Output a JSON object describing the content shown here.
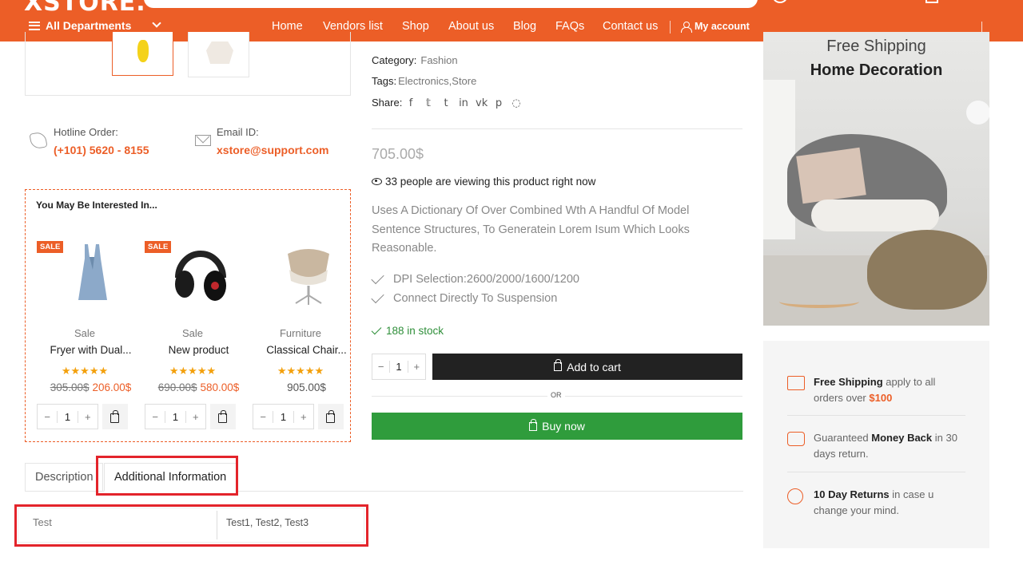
{
  "header": {
    "logo": "XSTORE.",
    "departments_label": "All Departments",
    "nav": [
      "Home",
      "Vendors list",
      "Shop",
      "About us",
      "Blog",
      "FAQs",
      "Contact us"
    ],
    "account_label": "My account"
  },
  "contact": {
    "hotline_label": "Hotline Order:",
    "hotline_value": "(+101) 5620 - 8155",
    "email_label": "Email ID:",
    "email_value": "xstore@support.com"
  },
  "interested": {
    "title": "You May Be Interested In...",
    "products": [
      {
        "badge": "SALE",
        "category": "Sale",
        "name": "Fryer with Dual...",
        "stars": "★★★★★",
        "old_price": "305.00$",
        "new_price": "206.00$",
        "qty": "1",
        "image": "dress-image"
      },
      {
        "badge": "SALE",
        "category": "Sale",
        "name": "New product",
        "stars": "★★★★★",
        "old_price": "690.00$",
        "new_price": "580.00$",
        "qty": "1",
        "image": "headphones-image"
      },
      {
        "badge": "",
        "category": "Furniture",
        "name": "Classical Chair...",
        "stars": "★★★★★",
        "old_price": "",
        "new_price": "905.00$",
        "qty": "1",
        "image": "chair-image"
      }
    ]
  },
  "tabs": {
    "description": "Description",
    "additional": "Additional Information"
  },
  "info_table": {
    "key": "Test",
    "value": "Test1, Test2, Test3"
  },
  "product": {
    "category_label": "Category:",
    "category_value": "Fashion",
    "tags_label": "Tags:",
    "tags_value": "Electronics,Store",
    "share_label": "Share:",
    "share_icons": [
      "facebook-icon",
      "twitter-icon",
      "tumblr-icon",
      "linkedin-icon",
      "vk-icon",
      "pinterest-icon",
      "whatsapp-icon"
    ],
    "price": "705.00$",
    "viewing": "33 people are viewing this product right now",
    "description": "Uses A Dictionary Of Over Combined Wth A Handful Of Model Sentence Structures, To Generatein Lorem Isum Which Looks Reasonable.",
    "features": [
      "DPI Selection:2600/2000/1600/1200",
      "Connect Directly To Suspension"
    ],
    "stock": "188 in stock",
    "qty": "1",
    "minus": "−",
    "plus": "+",
    "add_to_cart": "Add to cart",
    "or": "OR",
    "buy_now": "Buy now"
  },
  "banner": {
    "subtitle": "Free Shipping",
    "title": "Home Decoration"
  },
  "perks": {
    "shipping_bold": "Free Shipping",
    "shipping_text": " apply to all orders over ",
    "shipping_amount": "$100",
    "money_pre": "Guaranteed ",
    "money_bold": "Money Back",
    "money_text": " in 30 days return.",
    "returns_bold": "10 Day Returns",
    "returns_text": " in case u change your mind."
  },
  "colors": {
    "brand": "#ec5e27",
    "buy_green": "#2f9c3c",
    "highlight_red": "#e3242b"
  }
}
